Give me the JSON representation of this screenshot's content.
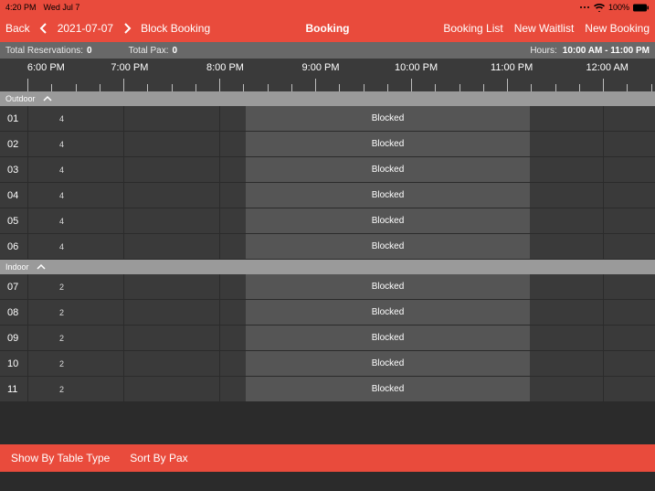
{
  "status": {
    "time": "4:20 PM",
    "date": "Wed Jul 7",
    "battery_pct": "100%"
  },
  "nav": {
    "back": "Back",
    "date": "2021-07-07",
    "block_booking": "Block Booking",
    "title": "Booking",
    "booking_list": "Booking List",
    "new_waitlist": "New Waitlist",
    "new_booking": "New Booking"
  },
  "summary": {
    "total_res_label": "Total Reservations:",
    "total_res_value": "0",
    "total_pax_label": "Total Pax:",
    "total_pax_value": "0",
    "hours_label": "Hours:",
    "hours_value": "10:00 AM - 11:00 PM"
  },
  "timeline": {
    "labels": [
      "6:00 PM",
      "7:00 PM",
      "8:00 PM",
      "9:00 PM",
      "10:00 PM",
      "11:00 PM",
      "12:00 AM"
    ]
  },
  "blocked_label": "Blocked",
  "sections": [
    {
      "name": "Outdoor",
      "rows": [
        {
          "num": "01",
          "cap": "4"
        },
        {
          "num": "02",
          "cap": "4"
        },
        {
          "num": "03",
          "cap": "4"
        },
        {
          "num": "04",
          "cap": "4"
        },
        {
          "num": "05",
          "cap": "4"
        },
        {
          "num": "06",
          "cap": "4"
        }
      ]
    },
    {
      "name": "Indoor",
      "rows": [
        {
          "num": "07",
          "cap": "2"
        },
        {
          "num": "08",
          "cap": "2"
        },
        {
          "num": "09",
          "cap": "2"
        },
        {
          "num": "10",
          "cap": "2"
        },
        {
          "num": "11",
          "cap": "2"
        }
      ]
    }
  ],
  "bottom": {
    "show_by_type": "Show By Table Type",
    "sort_by_pax": "Sort By Pax"
  }
}
